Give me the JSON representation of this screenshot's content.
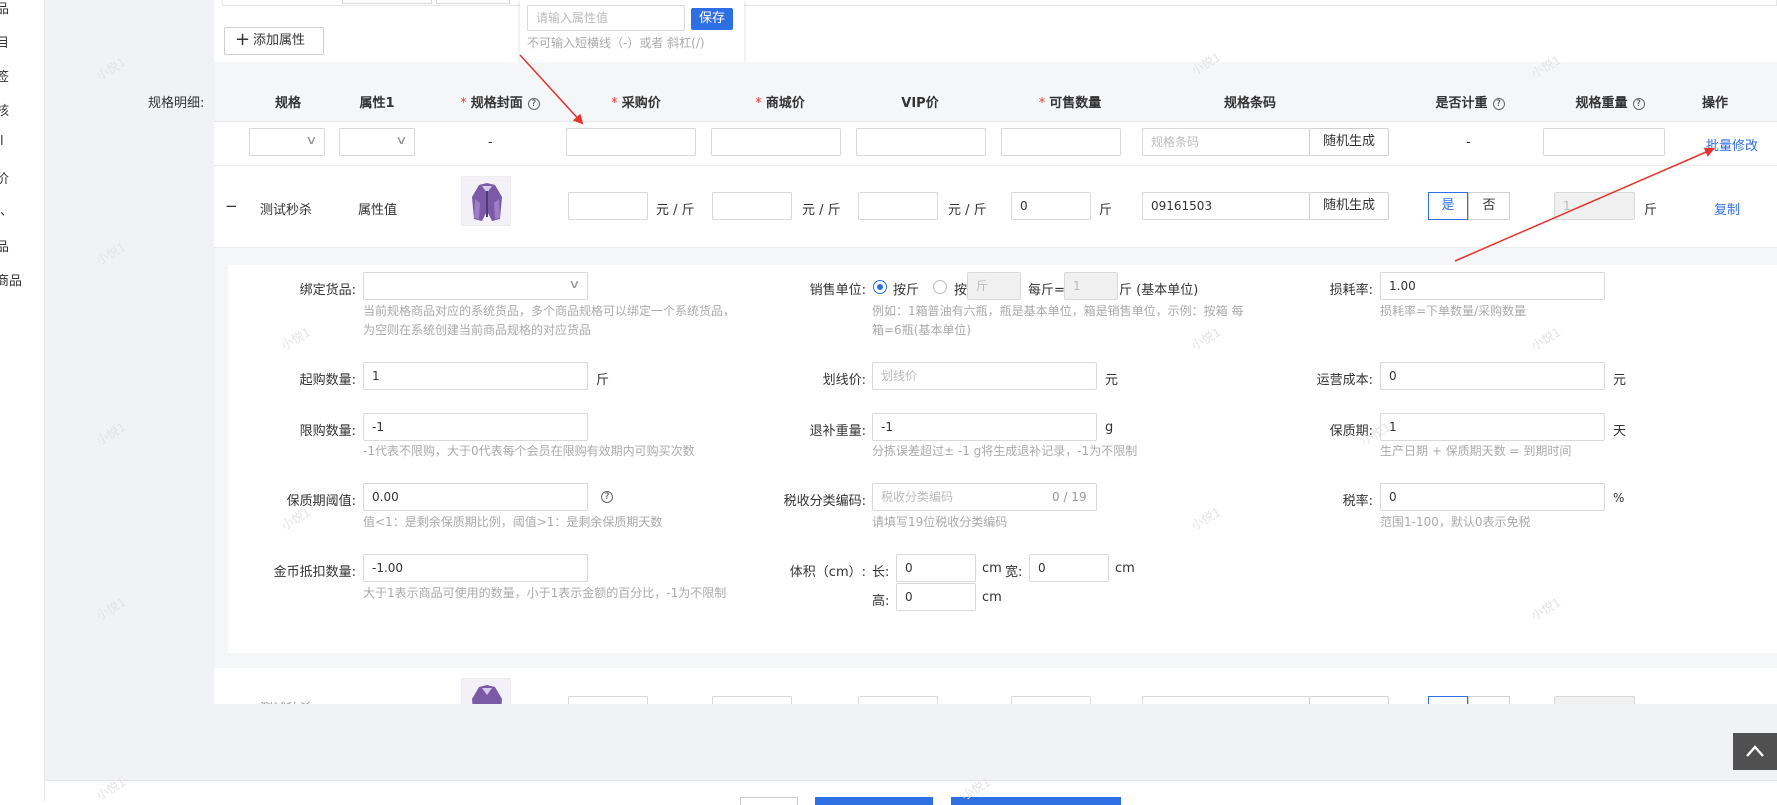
{
  "sidebar": {
    "items": [
      "品",
      "目",
      "签",
      "核",
      "l",
      "价",
      "、",
      "品",
      "商品"
    ]
  },
  "attributes": {
    "add_button_label": "添加属性",
    "popover": {
      "placeholder": "请输入属性值",
      "save_label": "保存",
      "hint": "不可输入短横线（-）或者 斜杠(/)"
    }
  },
  "spec": {
    "section_label": "规格明细:",
    "columns": [
      "规格",
      "属性1",
      "规格封面",
      "采购价",
      "商城价",
      "VIP价",
      "可售数量",
      "规格条码",
      "是否计重",
      "规格重量",
      "操作"
    ],
    "batch_row": {
      "cover": "-",
      "barcode_placeholder": "规格条码",
      "random_label": "随机生成",
      "weighing": "-",
      "action": "批量修改"
    },
    "row": {
      "toggle": "−",
      "spec_name": "测试秒杀",
      "attr_value": "属性值",
      "price_unit": "元 / 斤",
      "qty": "0",
      "qty_unit": "斤",
      "barcode": "09161503",
      "random_label": "随机生成",
      "yes": "是",
      "no": "否",
      "weight": "1",
      "weight_unit": "斤",
      "action": "复制"
    }
  },
  "detail": {
    "bind_goods": {
      "label": "绑定货品:",
      "hint": "当前规格商品对应的系统货品，多个商品规格可以绑定一个系统货品，为空则在系统创建当前商品规格的对应货品"
    },
    "sale_unit": {
      "label": "销售单位:",
      "opt1": "按斤",
      "opt2": "按",
      "opt2_placeholder": "斤",
      "per_label": "每斤=",
      "per_value": "1",
      "base_unit": "斤 (基本单位)",
      "hint": "例如：1箱普油有六瓶，瓶是基本单位，箱是销售单位，示例：按箱 每箱=6瓶(基本单位)"
    },
    "loss_rate": {
      "label": "损耗率:",
      "value": "1.00",
      "hint": "损耗率=下单数量/采购数量"
    },
    "min_buy": {
      "label": "起购数量:",
      "value": "1",
      "unit": "斤"
    },
    "strike_price": {
      "label": "划线价:",
      "placeholder": "划线价",
      "unit": "元"
    },
    "op_cost": {
      "label": "运营成本:",
      "value": "0",
      "unit": "元"
    },
    "limit_buy": {
      "label": "限购数量:",
      "value": "-1",
      "hint": "-1代表不限购，大于0代表每个会员在限购有效期内可购买次数"
    },
    "refund_weight": {
      "label": "退补重量:",
      "value": "-1",
      "unit": "g",
      "hint": "分拣误差超过± -1 g将生成退补记录，-1为不限制"
    },
    "shelf_life": {
      "label": "保质期:",
      "value": "1",
      "unit": "天",
      "hint": "生产日期 + 保质期天数 = 到期时间"
    },
    "shelf_threshold": {
      "label": "保质期阈值:",
      "value": "0.00",
      "hint": "值<1：是剩余保质期比例，阈值>1：是剩余保质期天数"
    },
    "tax_code": {
      "label": "税收分类编码:",
      "placeholder": "税收分类编码",
      "counter": "0 / 19",
      "hint": "请填写19位税收分类编码"
    },
    "tax_rate": {
      "label": "税率:",
      "value": "0",
      "unit": "%",
      "hint": "范围1-100，默认0表示免税"
    },
    "coin_deduct": {
      "label": "金币抵扣数量:",
      "value": "-1.00",
      "hint": "大于1表示商品可使用的数量，小于1表示金额的百分比，-1为不限制"
    },
    "volume": {
      "label": "体积（cm）:",
      "len_label": "长:",
      "len": "0",
      "wid_label": "宽:",
      "wid": "0",
      "hei_label": "高:",
      "hei": "0",
      "unit": "cm"
    }
  },
  "watermark_text": "小悦1",
  "colors": {
    "primary": "#2f6fe4",
    "required": "#e4393c",
    "annotation_arrow": "#e8322b"
  }
}
